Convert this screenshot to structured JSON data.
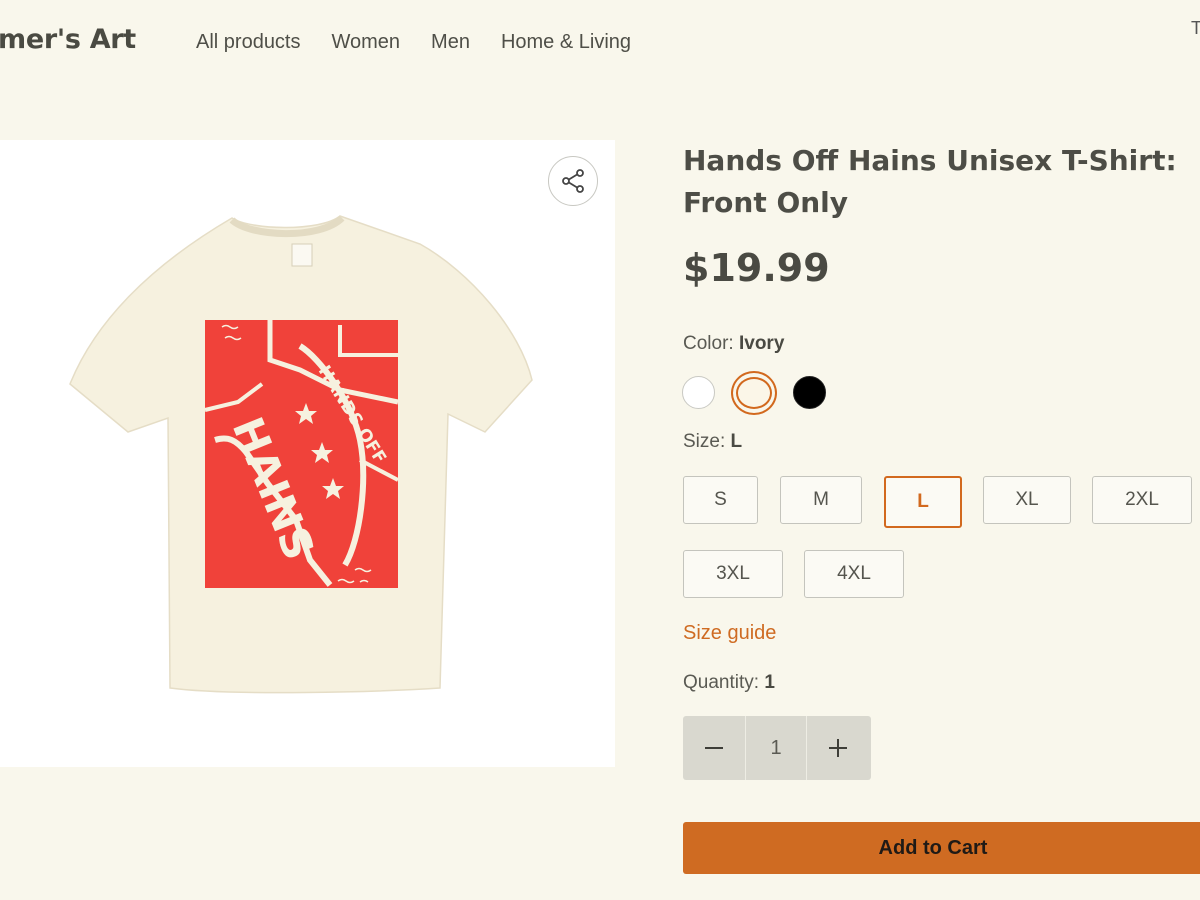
{
  "header": {
    "brand": "mer's Art",
    "nav": [
      "All products",
      "Women",
      "Men",
      "Home & Living"
    ],
    "top_right_mark": "T"
  },
  "product": {
    "title": "Hands Off Hains Unisex T-Shirt: Front Only",
    "price": "$19.99",
    "image_alt": "Ivory t-shirt with red HANDS OFF HAINS print",
    "print_text": [
      "HANDS OFF",
      "HAINS"
    ],
    "colors": {
      "shirt": "#f6f1df",
      "print": "#f0423a"
    }
  },
  "color": {
    "label": "Color:",
    "selected": "Ivory",
    "options": [
      {
        "name": "White",
        "hex": "#ffffff"
      },
      {
        "name": "Ivory",
        "hex": "#fbf6e8",
        "selected": true
      },
      {
        "name": "Black",
        "hex": "#000000"
      }
    ]
  },
  "size": {
    "label": "Size:",
    "selected": "L",
    "options": [
      "S",
      "M",
      "L",
      "XL",
      "2XL",
      "3XL",
      "4XL"
    ],
    "guide_label": "Size guide"
  },
  "quantity": {
    "label": "Quantity:",
    "value": "1",
    "minus": "−",
    "plus": "+"
  },
  "cart": {
    "button_label": "Add to Cart"
  },
  "theme": {
    "accent": "#cf6b22",
    "background": "#f9f7ec"
  }
}
